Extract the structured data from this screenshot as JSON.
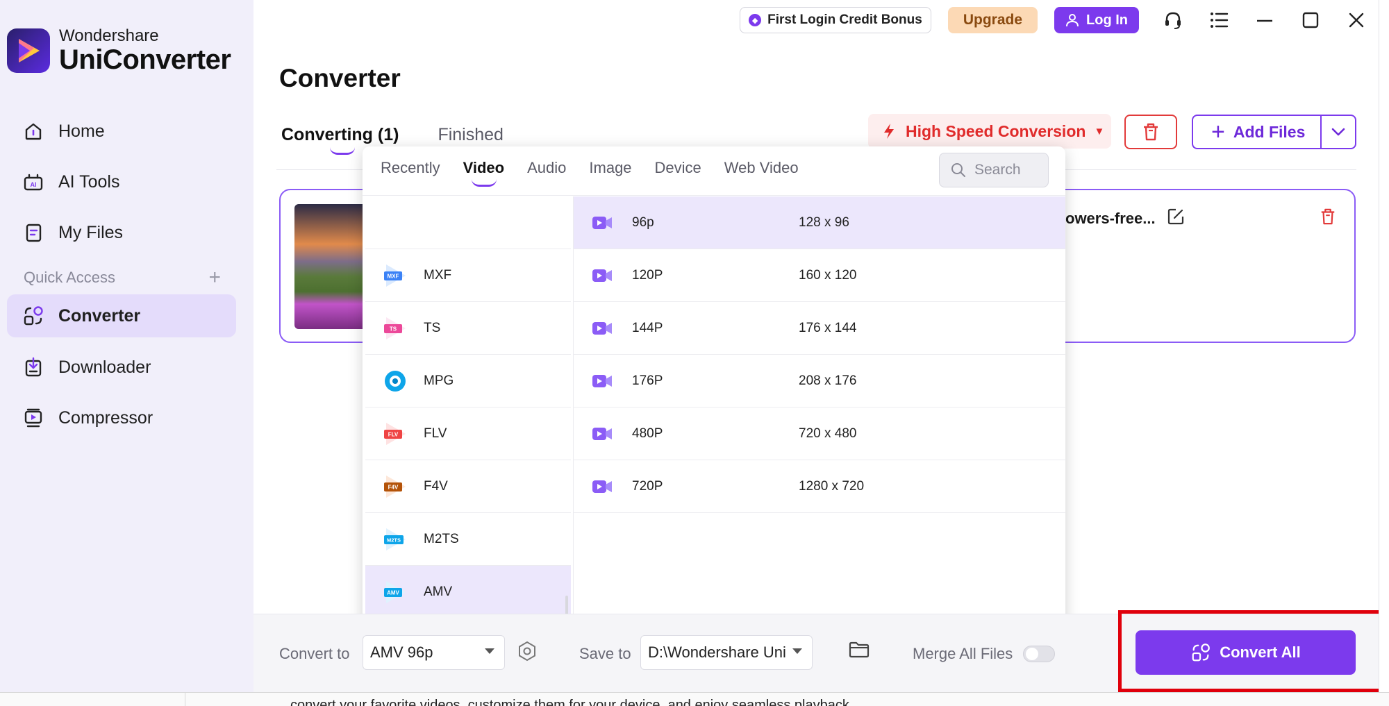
{
  "app": {
    "brand_top": "Wondershare",
    "brand_bottom": "UniConverter"
  },
  "topbar": {
    "bonus_label": "First Login Credit Bonus",
    "upgrade_label": "Upgrade",
    "login_label": "Log In",
    "icons": [
      "headset-icon",
      "list-icon",
      "minimize-icon",
      "maximize-icon",
      "close-icon"
    ]
  },
  "sidebar": {
    "items": [
      {
        "label": "Home",
        "icon": "home-icon"
      },
      {
        "label": "AI Tools",
        "icon": "ai-tools-icon"
      },
      {
        "label": "My Files",
        "icon": "my-files-icon"
      },
      {
        "label": "Converter",
        "icon": "converter-icon",
        "active": true
      },
      {
        "label": "Downloader",
        "icon": "downloader-icon"
      },
      {
        "label": "Compressor",
        "icon": "compressor-icon"
      }
    ],
    "quick_access_label": "Quick Access",
    "quick_access_add": "+"
  },
  "main": {
    "title": "Converter",
    "tabs": [
      {
        "label": "Converting (1)",
        "active": true
      },
      {
        "label": "Finished",
        "active": false
      }
    ],
    "high_speed_label": "High Speed Conversion",
    "add_files_label": "Add Files",
    "file_card": {
      "file_name": "owers-free..."
    }
  },
  "format_dropdown": {
    "tabs": [
      {
        "label": "Recently"
      },
      {
        "label": "Video",
        "active": true
      },
      {
        "label": "Audio"
      },
      {
        "label": "Image"
      },
      {
        "label": "Device"
      },
      {
        "label": "Web Video"
      }
    ],
    "search_placeholder": "Search",
    "formats": [
      {
        "label": "MXF",
        "badge": "MXF",
        "color": "#3b82f6"
      },
      {
        "label": "TS",
        "badge": "TS",
        "color": "#ec4899"
      },
      {
        "label": "MPG",
        "badge": "",
        "color": "#0ea5e9"
      },
      {
        "label": "FLV",
        "badge": "FLV",
        "color": "#ef4444"
      },
      {
        "label": "F4V",
        "badge": "F4V",
        "color": "#b45309"
      },
      {
        "label": "M2TS",
        "badge": "M2TS",
        "color": "#0ea5e9"
      },
      {
        "label": "AMV",
        "badge": "AMV",
        "color": "#0ea5e9",
        "selected": true
      }
    ],
    "resolutions": [
      {
        "name": "96p",
        "size": "128 x 96",
        "selected": true
      },
      {
        "name": "120P",
        "size": "160 x 120"
      },
      {
        "name": "144P",
        "size": "176 x 144"
      },
      {
        "name": "176P",
        "size": "208 x 176"
      },
      {
        "name": "480P",
        "size": "720 x 480"
      },
      {
        "name": "720P",
        "size": "1280 x 720"
      }
    ]
  },
  "bottombar": {
    "convert_to_label": "Convert to",
    "convert_to_value": "AMV 96p",
    "save_to_label": "Save to",
    "save_to_value": "D:\\Wondershare UniCor",
    "merge_label": "Merge All Files",
    "merge_on": false,
    "convert_all_label": "Convert All"
  },
  "footer": {
    "text": "convert your favorite videos, customize them for your device, and enjoy seamless playback."
  },
  "colors": {
    "accent": "#7c3aed",
    "danger": "#e02b2b",
    "sidebar_bg": "#f1effa",
    "highlight": "#e0000c"
  }
}
